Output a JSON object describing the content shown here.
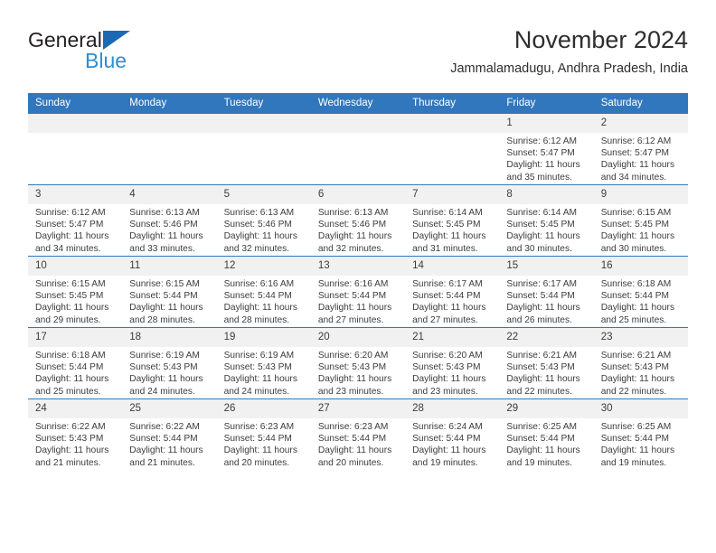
{
  "brand": {
    "name_part1": "General",
    "name_part2": "Blue",
    "logo_icon": "triangle-flag-icon",
    "accent_color": "#1b69b2",
    "accent_color_light": "#2b8fd4"
  },
  "header": {
    "title": "November 2024",
    "subtitle": "Jammalamadugu, Andhra Pradesh, India"
  },
  "calendar": {
    "header_bg": "#3177be",
    "daynum_bg": "#f1f1f1",
    "weekday_headers": [
      "Sunday",
      "Monday",
      "Tuesday",
      "Wednesday",
      "Thursday",
      "Friday",
      "Saturday"
    ],
    "weeks": [
      [
        {
          "day": "",
          "sunrise": "",
          "sunset": "",
          "daylight_line1": "",
          "daylight_line2": ""
        },
        {
          "day": "",
          "sunrise": "",
          "sunset": "",
          "daylight_line1": "",
          "daylight_line2": ""
        },
        {
          "day": "",
          "sunrise": "",
          "sunset": "",
          "daylight_line1": "",
          "daylight_line2": ""
        },
        {
          "day": "",
          "sunrise": "",
          "sunset": "",
          "daylight_line1": "",
          "daylight_line2": ""
        },
        {
          "day": "",
          "sunrise": "",
          "sunset": "",
          "daylight_line1": "",
          "daylight_line2": ""
        },
        {
          "day": "1",
          "sunrise": "Sunrise: 6:12 AM",
          "sunset": "Sunset: 5:47 PM",
          "daylight_line1": "Daylight: 11 hours",
          "daylight_line2": "and 35 minutes."
        },
        {
          "day": "2",
          "sunrise": "Sunrise: 6:12 AM",
          "sunset": "Sunset: 5:47 PM",
          "daylight_line1": "Daylight: 11 hours",
          "daylight_line2": "and 34 minutes."
        }
      ],
      [
        {
          "day": "3",
          "sunrise": "Sunrise: 6:12 AM",
          "sunset": "Sunset: 5:47 PM",
          "daylight_line1": "Daylight: 11 hours",
          "daylight_line2": "and 34 minutes."
        },
        {
          "day": "4",
          "sunrise": "Sunrise: 6:13 AM",
          "sunset": "Sunset: 5:46 PM",
          "daylight_line1": "Daylight: 11 hours",
          "daylight_line2": "and 33 minutes."
        },
        {
          "day": "5",
          "sunrise": "Sunrise: 6:13 AM",
          "sunset": "Sunset: 5:46 PM",
          "daylight_line1": "Daylight: 11 hours",
          "daylight_line2": "and 32 minutes."
        },
        {
          "day": "6",
          "sunrise": "Sunrise: 6:13 AM",
          "sunset": "Sunset: 5:46 PM",
          "daylight_line1": "Daylight: 11 hours",
          "daylight_line2": "and 32 minutes."
        },
        {
          "day": "7",
          "sunrise": "Sunrise: 6:14 AM",
          "sunset": "Sunset: 5:45 PM",
          "daylight_line1": "Daylight: 11 hours",
          "daylight_line2": "and 31 minutes."
        },
        {
          "day": "8",
          "sunrise": "Sunrise: 6:14 AM",
          "sunset": "Sunset: 5:45 PM",
          "daylight_line1": "Daylight: 11 hours",
          "daylight_line2": "and 30 minutes."
        },
        {
          "day": "9",
          "sunrise": "Sunrise: 6:15 AM",
          "sunset": "Sunset: 5:45 PM",
          "daylight_line1": "Daylight: 11 hours",
          "daylight_line2": "and 30 minutes."
        }
      ],
      [
        {
          "day": "10",
          "sunrise": "Sunrise: 6:15 AM",
          "sunset": "Sunset: 5:45 PM",
          "daylight_line1": "Daylight: 11 hours",
          "daylight_line2": "and 29 minutes."
        },
        {
          "day": "11",
          "sunrise": "Sunrise: 6:15 AM",
          "sunset": "Sunset: 5:44 PM",
          "daylight_line1": "Daylight: 11 hours",
          "daylight_line2": "and 28 minutes."
        },
        {
          "day": "12",
          "sunrise": "Sunrise: 6:16 AM",
          "sunset": "Sunset: 5:44 PM",
          "daylight_line1": "Daylight: 11 hours",
          "daylight_line2": "and 28 minutes."
        },
        {
          "day": "13",
          "sunrise": "Sunrise: 6:16 AM",
          "sunset": "Sunset: 5:44 PM",
          "daylight_line1": "Daylight: 11 hours",
          "daylight_line2": "and 27 minutes."
        },
        {
          "day": "14",
          "sunrise": "Sunrise: 6:17 AM",
          "sunset": "Sunset: 5:44 PM",
          "daylight_line1": "Daylight: 11 hours",
          "daylight_line2": "and 27 minutes."
        },
        {
          "day": "15",
          "sunrise": "Sunrise: 6:17 AM",
          "sunset": "Sunset: 5:44 PM",
          "daylight_line1": "Daylight: 11 hours",
          "daylight_line2": "and 26 minutes."
        },
        {
          "day": "16",
          "sunrise": "Sunrise: 6:18 AM",
          "sunset": "Sunset: 5:44 PM",
          "daylight_line1": "Daylight: 11 hours",
          "daylight_line2": "and 25 minutes."
        }
      ],
      [
        {
          "day": "17",
          "sunrise": "Sunrise: 6:18 AM",
          "sunset": "Sunset: 5:44 PM",
          "daylight_line1": "Daylight: 11 hours",
          "daylight_line2": "and 25 minutes."
        },
        {
          "day": "18",
          "sunrise": "Sunrise: 6:19 AM",
          "sunset": "Sunset: 5:43 PM",
          "daylight_line1": "Daylight: 11 hours",
          "daylight_line2": "and 24 minutes."
        },
        {
          "day": "19",
          "sunrise": "Sunrise: 6:19 AM",
          "sunset": "Sunset: 5:43 PM",
          "daylight_line1": "Daylight: 11 hours",
          "daylight_line2": "and 24 minutes."
        },
        {
          "day": "20",
          "sunrise": "Sunrise: 6:20 AM",
          "sunset": "Sunset: 5:43 PM",
          "daylight_line1": "Daylight: 11 hours",
          "daylight_line2": "and 23 minutes."
        },
        {
          "day": "21",
          "sunrise": "Sunrise: 6:20 AM",
          "sunset": "Sunset: 5:43 PM",
          "daylight_line1": "Daylight: 11 hours",
          "daylight_line2": "and 23 minutes."
        },
        {
          "day": "22",
          "sunrise": "Sunrise: 6:21 AM",
          "sunset": "Sunset: 5:43 PM",
          "daylight_line1": "Daylight: 11 hours",
          "daylight_line2": "and 22 minutes."
        },
        {
          "day": "23",
          "sunrise": "Sunrise: 6:21 AM",
          "sunset": "Sunset: 5:43 PM",
          "daylight_line1": "Daylight: 11 hours",
          "daylight_line2": "and 22 minutes."
        }
      ],
      [
        {
          "day": "24",
          "sunrise": "Sunrise: 6:22 AM",
          "sunset": "Sunset: 5:43 PM",
          "daylight_line1": "Daylight: 11 hours",
          "daylight_line2": "and 21 minutes."
        },
        {
          "day": "25",
          "sunrise": "Sunrise: 6:22 AM",
          "sunset": "Sunset: 5:44 PM",
          "daylight_line1": "Daylight: 11 hours",
          "daylight_line2": "and 21 minutes."
        },
        {
          "day": "26",
          "sunrise": "Sunrise: 6:23 AM",
          "sunset": "Sunset: 5:44 PM",
          "daylight_line1": "Daylight: 11 hours",
          "daylight_line2": "and 20 minutes."
        },
        {
          "day": "27",
          "sunrise": "Sunrise: 6:23 AM",
          "sunset": "Sunset: 5:44 PM",
          "daylight_line1": "Daylight: 11 hours",
          "daylight_line2": "and 20 minutes."
        },
        {
          "day": "28",
          "sunrise": "Sunrise: 6:24 AM",
          "sunset": "Sunset: 5:44 PM",
          "daylight_line1": "Daylight: 11 hours",
          "daylight_line2": "and 19 minutes."
        },
        {
          "day": "29",
          "sunrise": "Sunrise: 6:25 AM",
          "sunset": "Sunset: 5:44 PM",
          "daylight_line1": "Daylight: 11 hours",
          "daylight_line2": "and 19 minutes."
        },
        {
          "day": "30",
          "sunrise": "Sunrise: 6:25 AM",
          "sunset": "Sunset: 5:44 PM",
          "daylight_line1": "Daylight: 11 hours",
          "daylight_line2": "and 19 minutes."
        }
      ]
    ]
  }
}
